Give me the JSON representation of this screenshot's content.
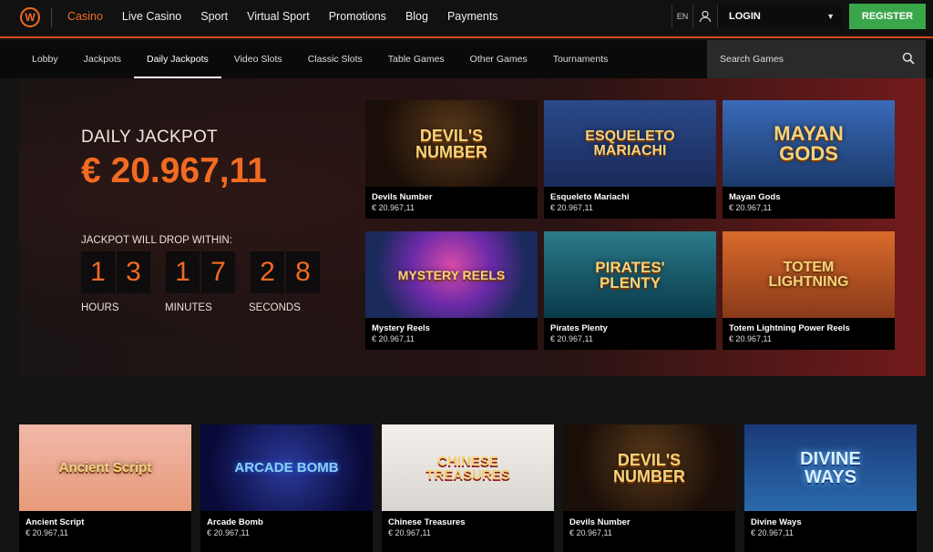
{
  "header": {
    "logo_glyph": "W",
    "nav": [
      "Casino",
      "Live Casino",
      "Sport",
      "Virtual Sport",
      "Promotions",
      "Blog",
      "Payments"
    ],
    "lang": "EN",
    "login_label": "LOGIN",
    "register_label": "REGISTER",
    "accent_color": "#f26b21",
    "register_color": "#3aa64a"
  },
  "subnav": {
    "tabs": [
      "Lobby",
      "Jackpots",
      "Daily Jackpots",
      "Video Slots",
      "Classic Slots",
      "Table Games",
      "Other Games",
      "Tournaments"
    ],
    "active_tab": "Daily Jackpots",
    "search_placeholder": "Search Games"
  },
  "jackpot": {
    "title": "DAILY JACKPOT",
    "amount": "€ 20.967,11",
    "drop_label": "JACKPOT WILL DROP WITHIN:",
    "digits": [
      "1",
      "3",
      "1",
      "7",
      "2",
      "8"
    ],
    "units": [
      "HOURS",
      "MINUTES",
      "SECONDS"
    ]
  },
  "featured_games": [
    {
      "name": "Devils Number",
      "amount": "€ 20.967,11",
      "art": "DEVIL'S NUMBER"
    },
    {
      "name": "Esqueleto Mariachi",
      "amount": "€ 20.967,11",
      "art": "ESQUELETO MARIACHI"
    },
    {
      "name": "Mayan Gods",
      "amount": "€ 20.967,11",
      "art": "MAYAN GODS"
    },
    {
      "name": "Mystery Reels",
      "amount": "€ 20.967,11",
      "art": "MYSTERY REELS"
    },
    {
      "name": "Pirates Plenty",
      "amount": "€ 20.967,11",
      "art": "PIRATES' PLENTY"
    },
    {
      "name": "Totem Lightning Power Reels",
      "amount": "€ 20.967,11",
      "art": "TOTEM LIGHTNING"
    }
  ],
  "more_games": [
    {
      "name": "Ancient Script",
      "amount": "€ 20.967,11",
      "art": "Ancient Script"
    },
    {
      "name": "Arcade Bomb",
      "amount": "€ 20.967,11",
      "art": "ARCADE BOMB"
    },
    {
      "name": "Chinese Treasures",
      "amount": "€ 20.967,11",
      "art": "CHINESE TREASURES"
    },
    {
      "name": "Devils Number",
      "amount": "€ 20.967,11",
      "art": "DEVIL'S NUMBER"
    },
    {
      "name": "Divine Ways",
      "amount": "€ 20.967,11",
      "art": "DIVINE WAYS"
    }
  ]
}
